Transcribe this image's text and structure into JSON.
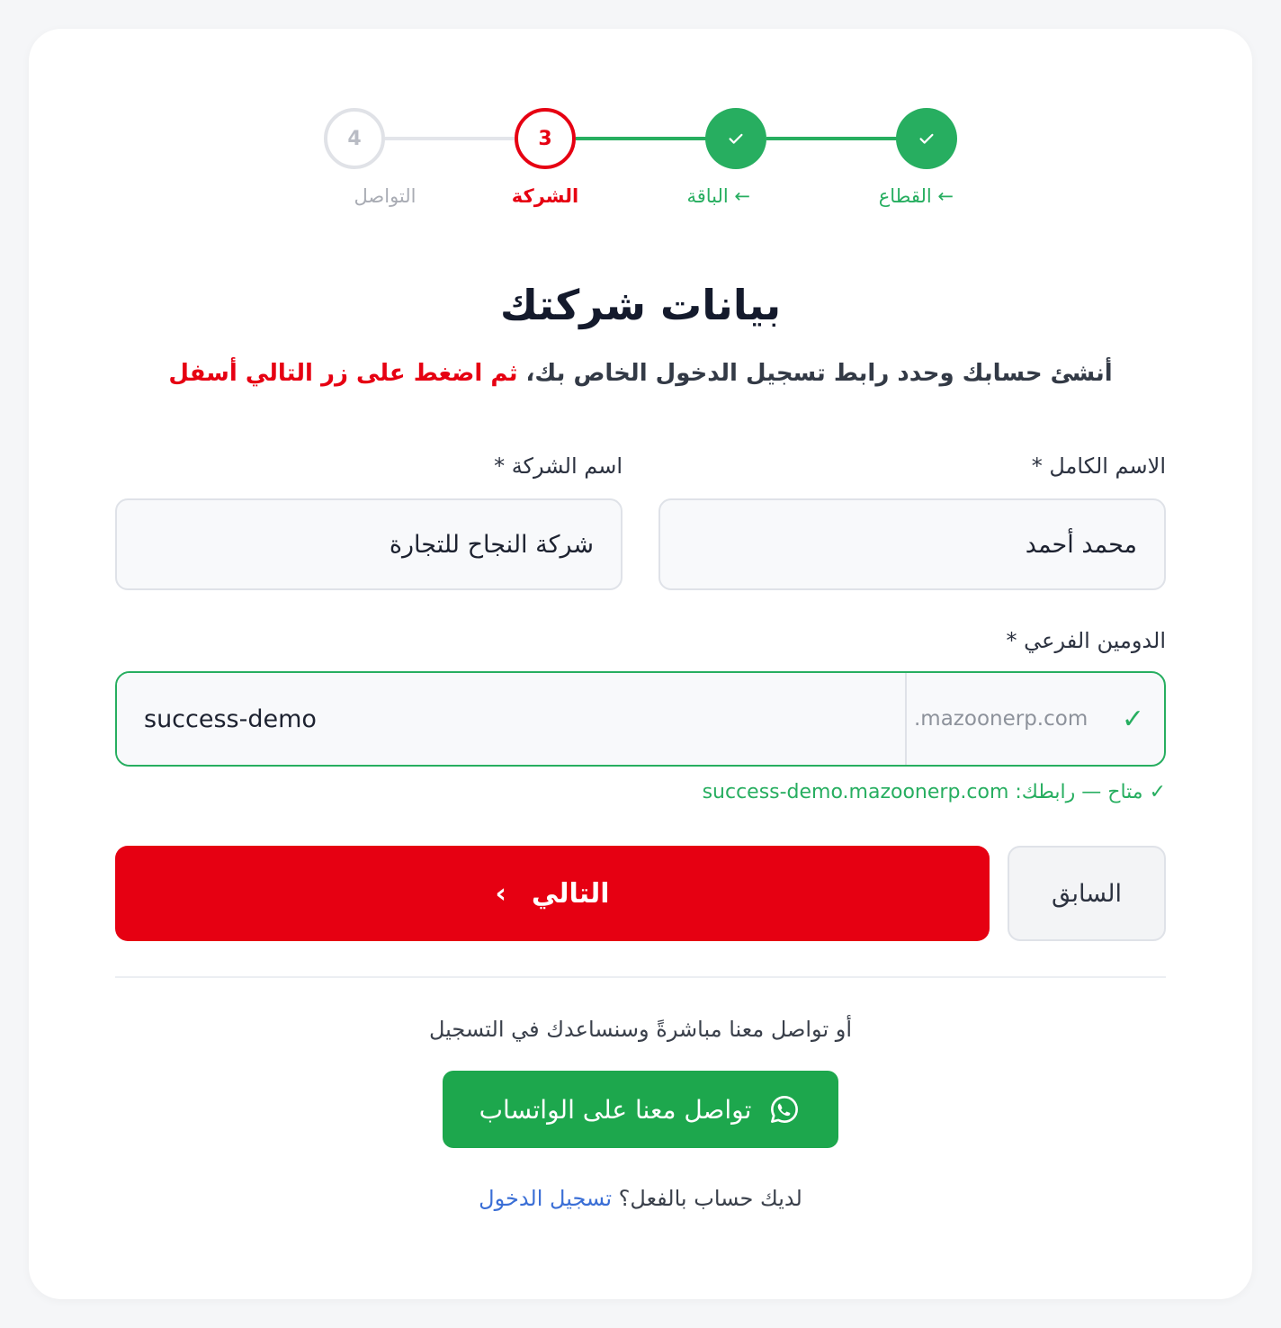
{
  "stepper": {
    "steps": [
      {
        "label": "القطاع ←",
        "state": "done",
        "number": ""
      },
      {
        "label": "الباقة ←",
        "state": "done",
        "number": ""
      },
      {
        "label": "الشركة",
        "state": "active",
        "number": "3"
      },
      {
        "label": "التواصل",
        "state": "todo",
        "number": "4"
      }
    ]
  },
  "heading": {
    "title": "بيانات شركتك",
    "subtitle_main": "أنشئ حسابك وحدد رابط تسجيل الدخول الخاص بك،",
    "subtitle_highlight": "ثم اضغط على زر التالي أسفل"
  },
  "form": {
    "full_name": {
      "label": "الاسم الكامل *",
      "value": "محمد أحمد"
    },
    "company_name": {
      "label": "اسم الشركة *",
      "value": "شركة النجاح للتجارة"
    },
    "subdomain": {
      "label": "الدومين الفرعي *",
      "value": "success-demo",
      "suffix": ".mazoonerp.com",
      "check": "✓",
      "availability": "✓ متاح — رابطك: success-demo.mazoonerp.com"
    }
  },
  "buttons": {
    "next_label": "التالي",
    "next_chevron": "›",
    "prev_label": "السابق"
  },
  "contact": {
    "or_text": "أو تواصل معنا مباشرةً وسنساعدك في التسجيل",
    "whatsapp_label": "تواصل معنا على الواتساب"
  },
  "login": {
    "question": "لديك حساب بالفعل؟",
    "link": "تسجيل الدخول"
  },
  "colors": {
    "accent_red": "#e60012",
    "success_green": "#27ae60",
    "whatsapp_green": "#1da74d",
    "link_blue": "#3b6fd6"
  }
}
